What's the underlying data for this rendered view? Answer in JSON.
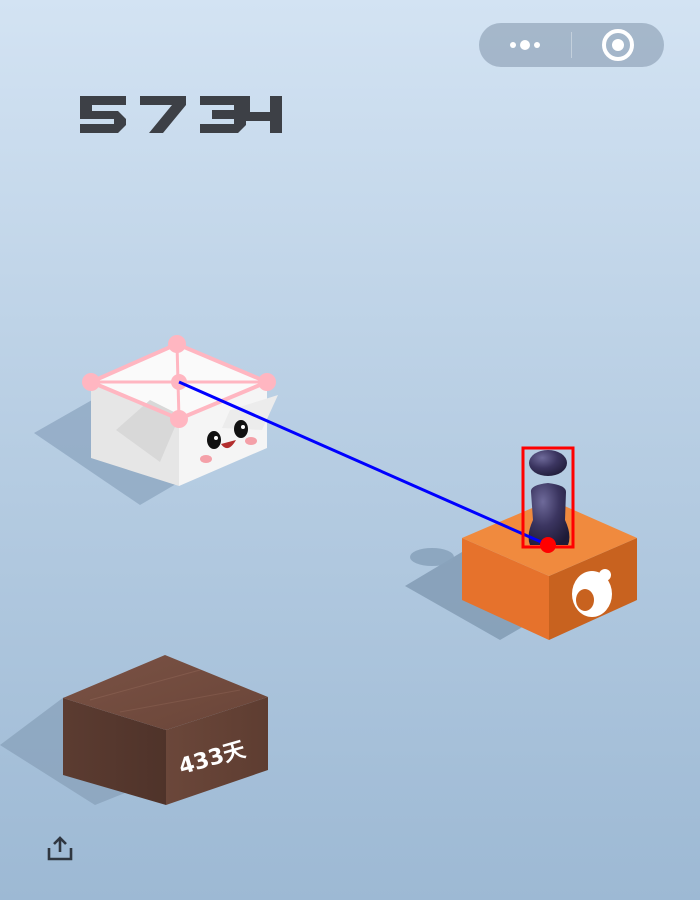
{
  "game": {
    "score": "5734",
    "player_state": "charging"
  },
  "blocks": [
    {
      "id": "target",
      "kind": "white-box-with-panda-face",
      "color": "#f2f2f2",
      "highlighted": true
    },
    {
      "id": "current",
      "kind": "orange-box-with-logo",
      "color": "#f07f32"
    },
    {
      "id": "previous",
      "kind": "wooden-box",
      "color": "#6f4638",
      "label": "433天"
    }
  ],
  "annotations": {
    "trajectory_color": "#0000ff",
    "player_box_color": "#ff0000",
    "target_marker_color": "#ffb6c1"
  },
  "capsule": {
    "more_icon": "three-dots",
    "close_icon": "target-circle"
  },
  "share_icon": "share-upload"
}
